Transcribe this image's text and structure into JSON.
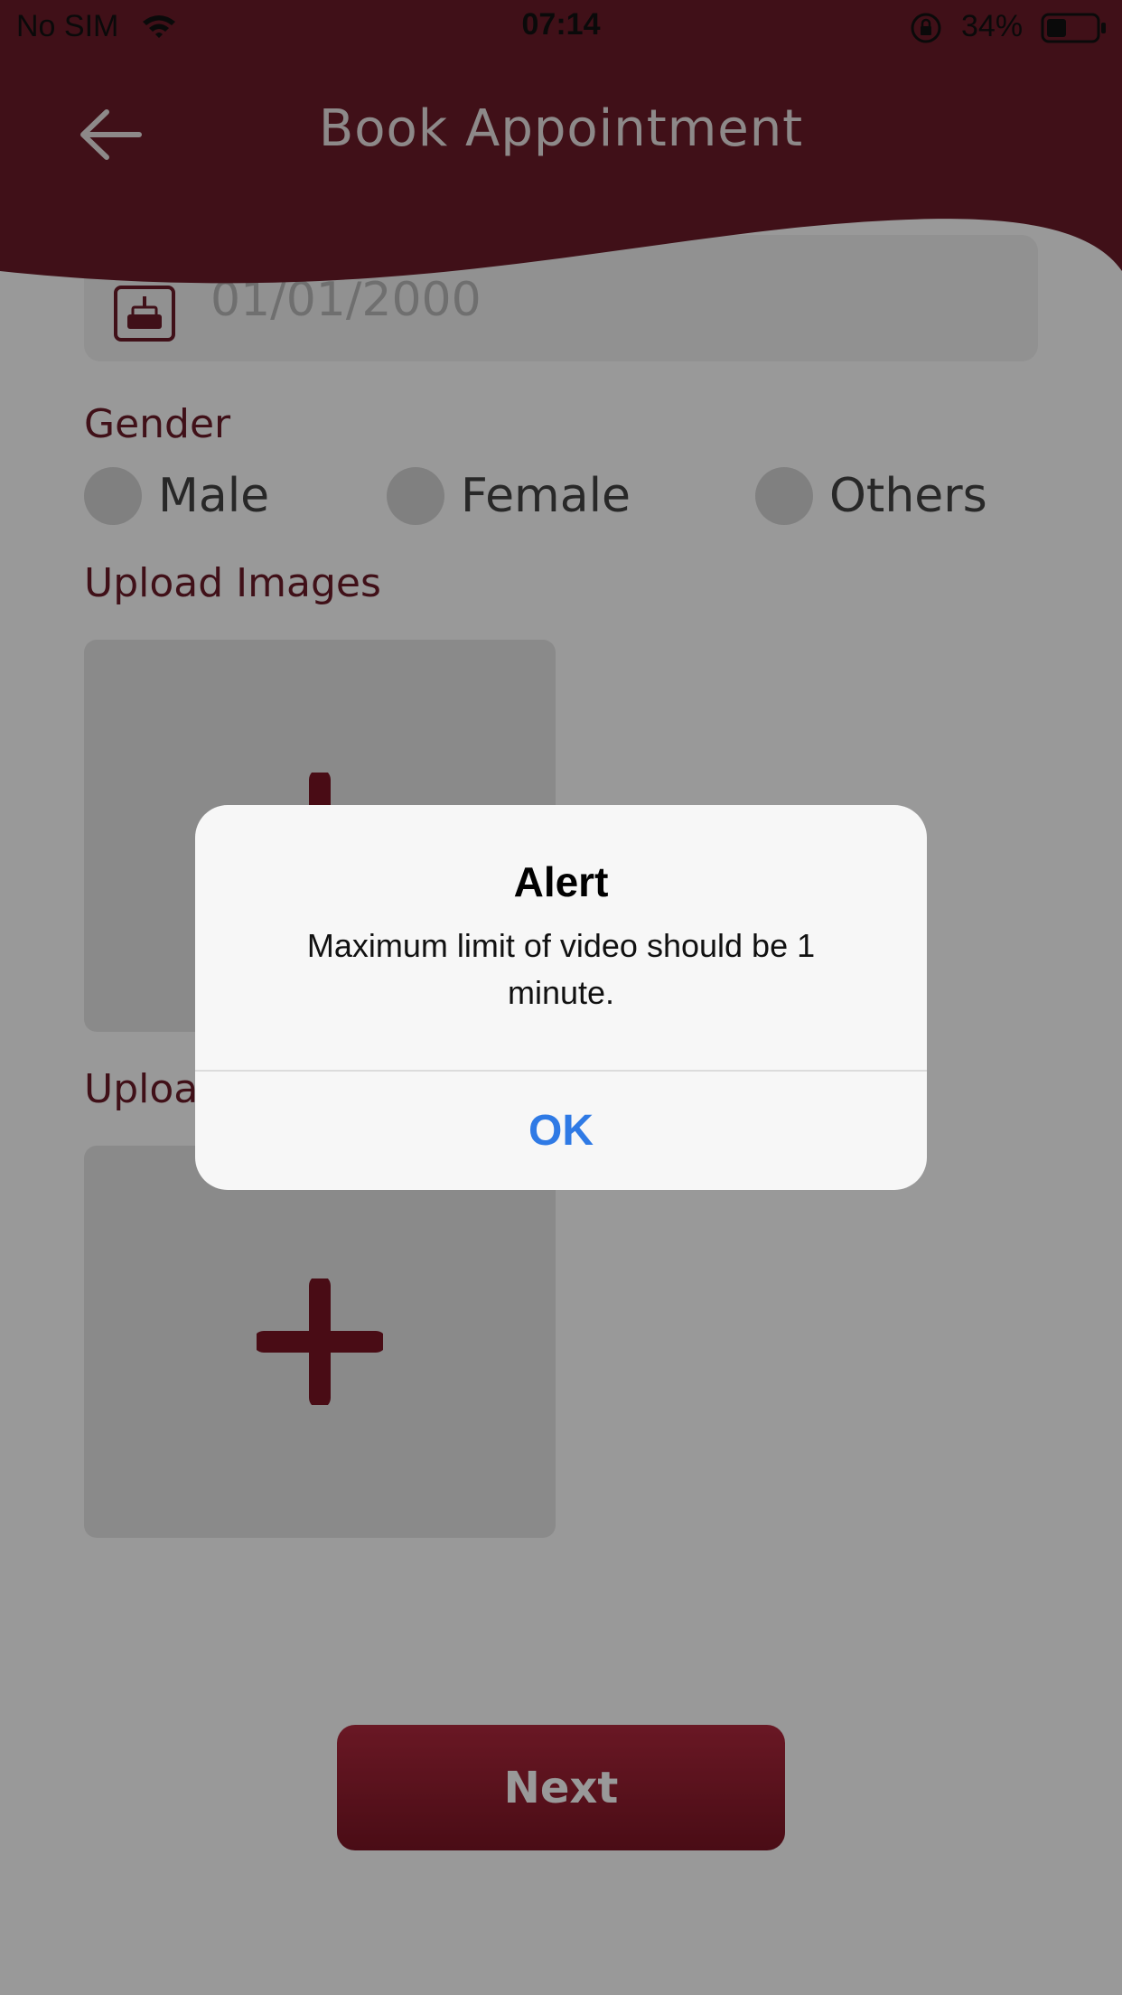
{
  "status_bar": {
    "carrier": "No SIM",
    "time": "07:14",
    "battery_percent": "34%"
  },
  "header": {
    "title": "Book Appointment"
  },
  "form": {
    "dob_value": "01/01/2000",
    "gender_label": "Gender",
    "gender_options": [
      "Male",
      "Female",
      "Others"
    ],
    "upload_images_label": "Upload Images",
    "upload_video_label": "Upload Video",
    "next_label": "Next"
  },
  "alert": {
    "title": "Alert",
    "message": "Maximum limit of video should be 1 minute.",
    "ok_label": "OK"
  },
  "colors": {
    "brand": "#7b1524",
    "header": "#6b1b28",
    "link_blue": "#2f7ae5"
  }
}
